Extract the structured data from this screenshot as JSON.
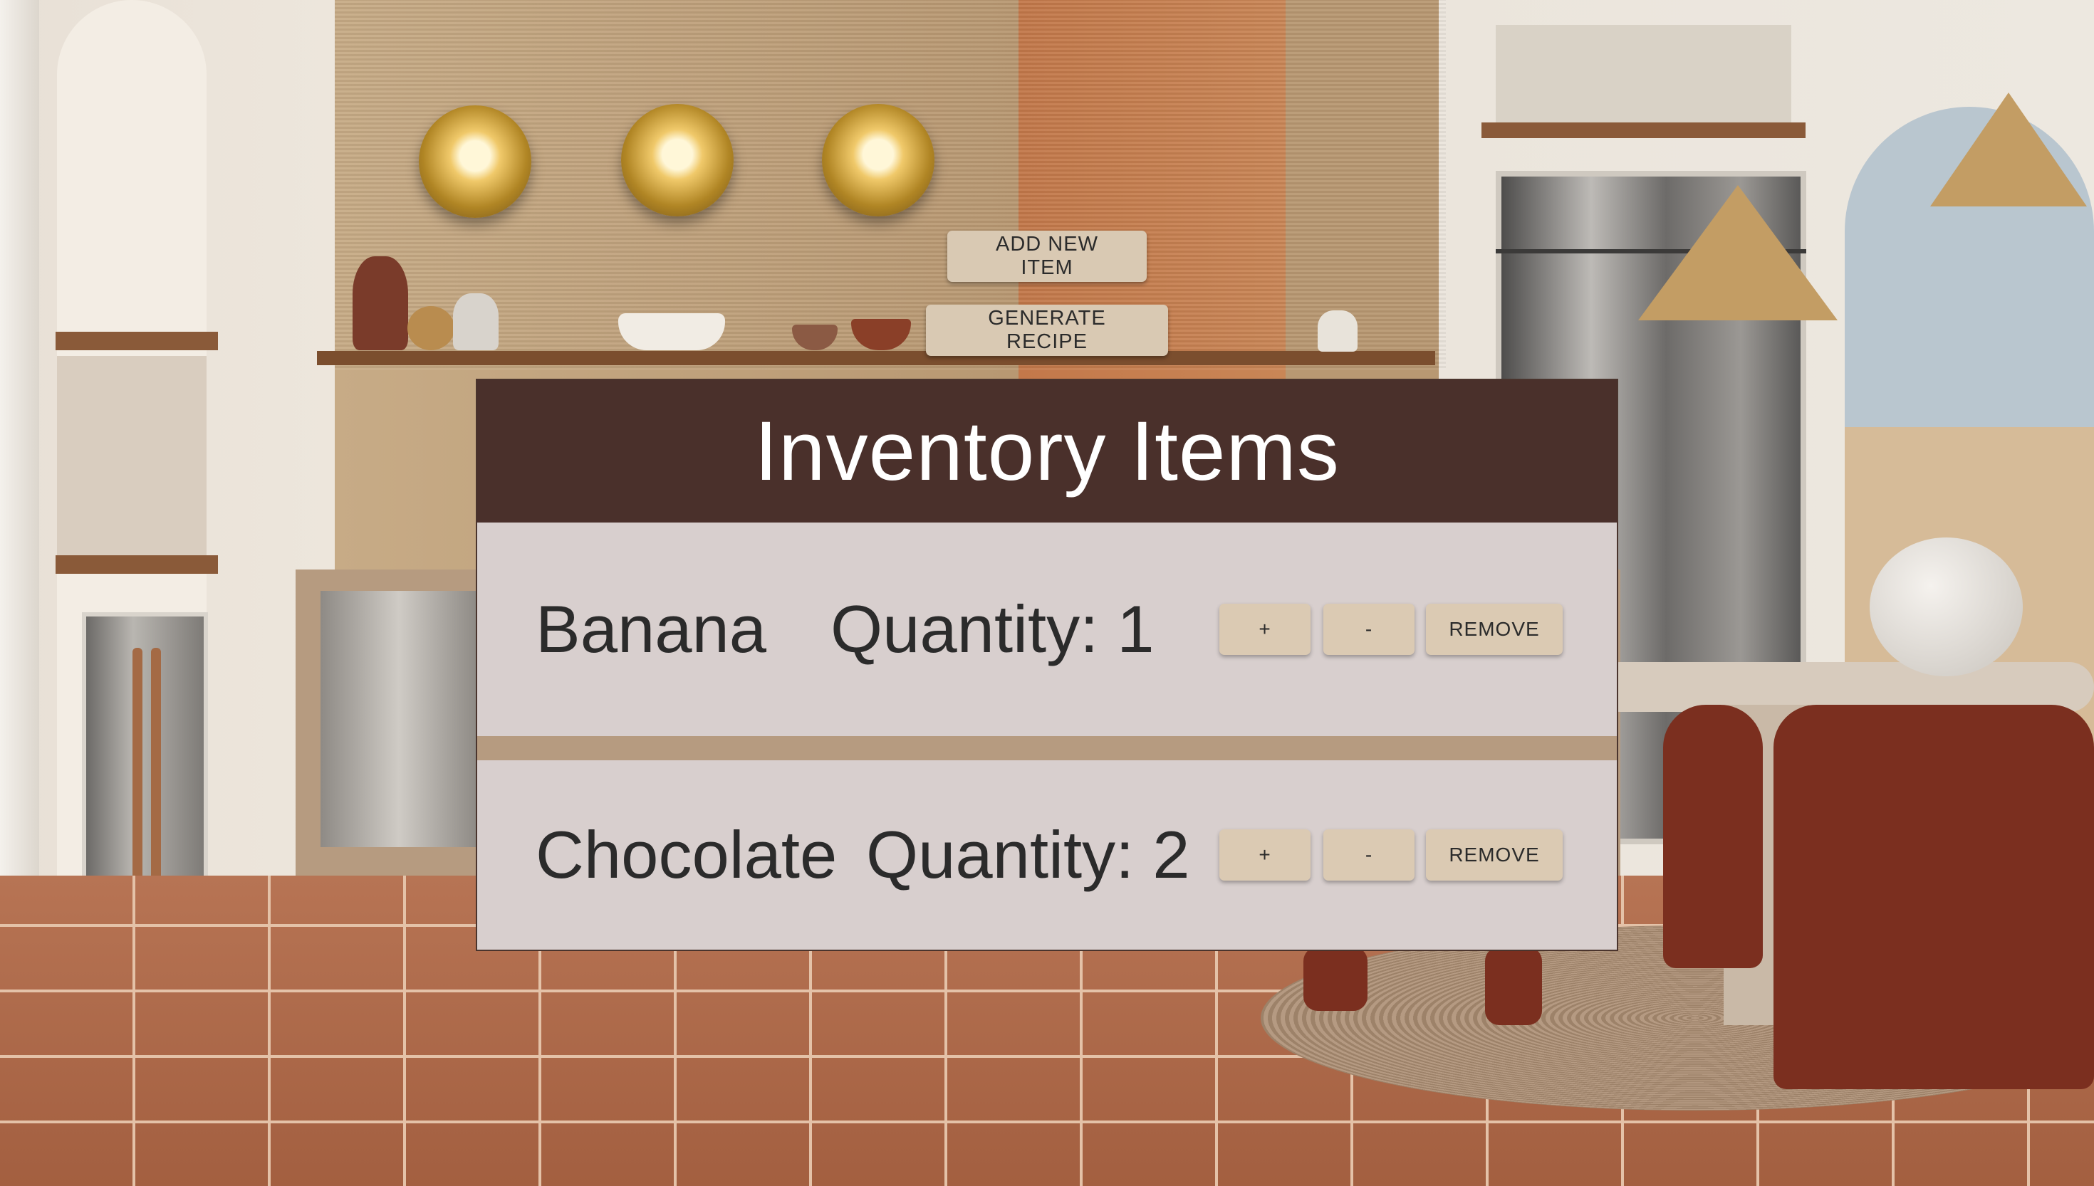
{
  "toolbar": {
    "add_label": "ADD NEW ITEM",
    "recipe_label": "GENERATE RECIPE"
  },
  "inventory": {
    "title": "Inventory Items",
    "items": [
      {
        "name": "Banana",
        "quantity_text": "Quantity: 1",
        "quantity": 1
      },
      {
        "name": "Chocolate",
        "quantity_text": "Quantity: 2",
        "quantity": 2
      }
    ],
    "increment_label": "+",
    "decrement_label": "-",
    "remove_label": "REMOVE"
  },
  "colors": {
    "header_bg": "#4a302b",
    "row_bg": "#d8cfce",
    "button_bg": "#d9c9b3",
    "text": "#2b2b2b"
  }
}
